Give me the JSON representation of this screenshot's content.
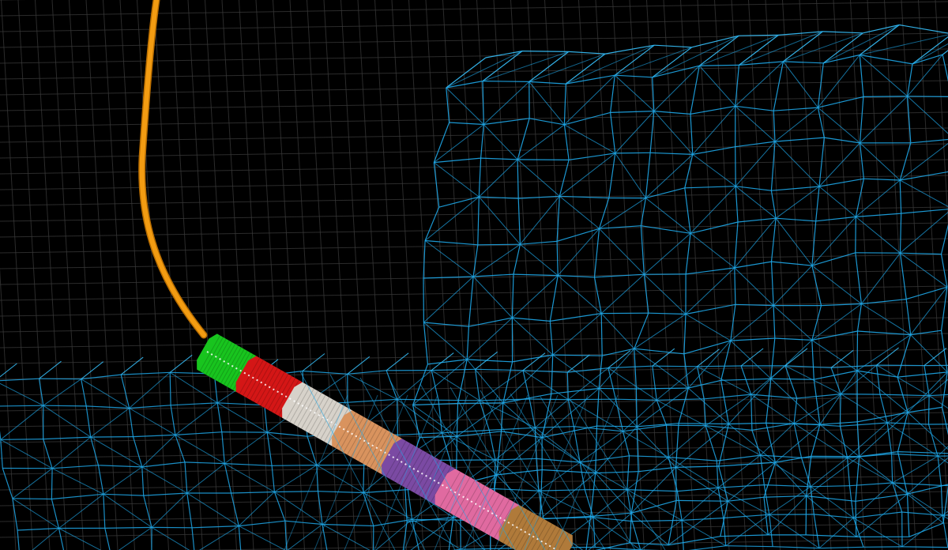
{
  "viewport": {
    "background": "#000000",
    "grid_color": "#3a3a3a",
    "mesh_color": "#1ea7e8",
    "mesh_highlight": "#37c3ff",
    "borehole_color": "#f39c12",
    "borehole_edge": "#b86d00",
    "segment_colors": [
      "#18c41e",
      "#d41616",
      "#d7d2ca",
      "#d9935e",
      "#7b4aa3",
      "#e06aa0",
      "#b07a3a"
    ]
  }
}
